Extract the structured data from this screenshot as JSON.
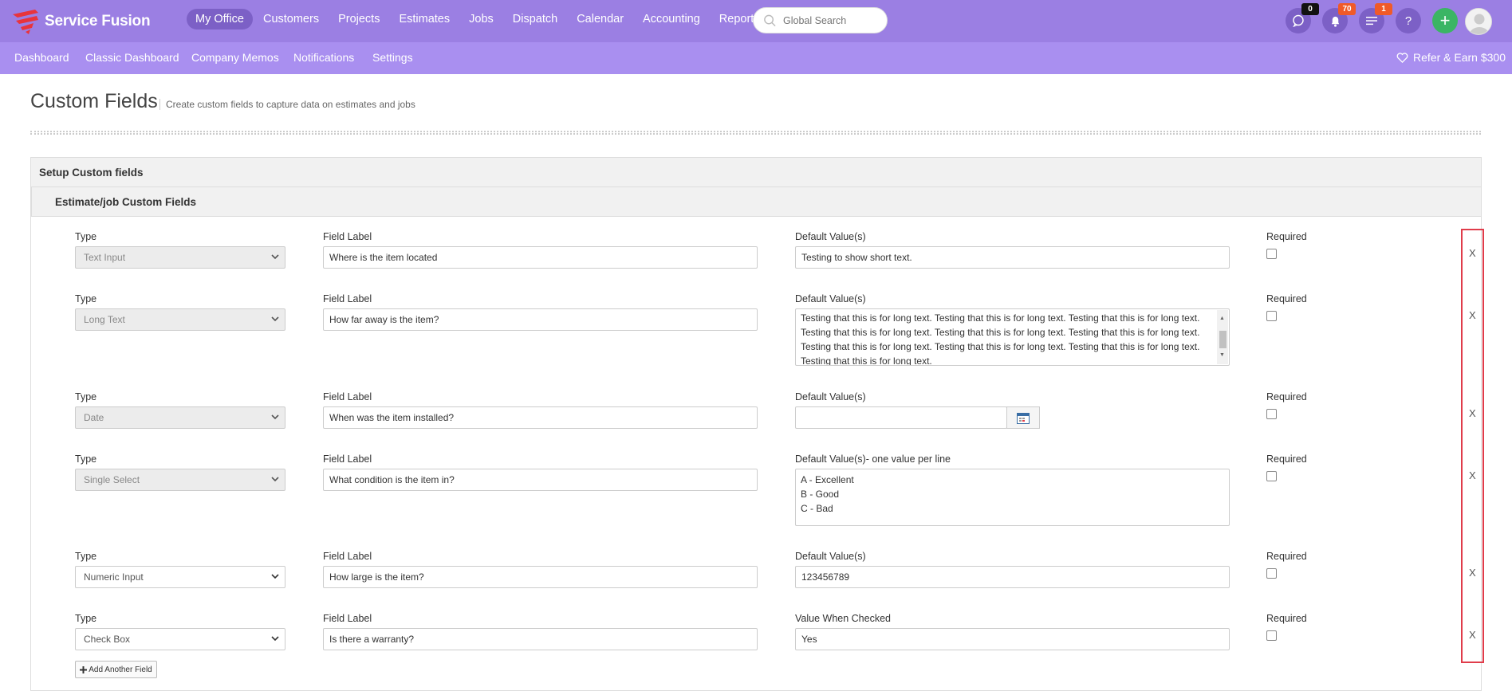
{
  "brand": {
    "name": "Service Fusion"
  },
  "main_nav": [
    "My Office",
    "Customers",
    "Projects",
    "Estimates",
    "Jobs",
    "Dispatch",
    "Calendar",
    "Accounting",
    "Reports"
  ],
  "search": {
    "placeholder": "Global Search"
  },
  "badges": {
    "messages": "0",
    "notifications": "70",
    "tasks": "1"
  },
  "top_icons": {
    "help": "?",
    "add": "+"
  },
  "sub_nav": [
    "Dashboard",
    "Classic Dashboard",
    "Company Memos",
    "Notifications",
    "Settings"
  ],
  "refer": "Refer & Earn $300",
  "page": {
    "title": "Custom Fields",
    "subtitle": "Create custom fields to capture data on estimates and jobs"
  },
  "panel": {
    "title": "Setup Custom fields",
    "subtitle": "Estimate/job Custom Fields"
  },
  "labels": {
    "type": "Type",
    "field_label": "Field Label",
    "required": "Required",
    "remove": "X"
  },
  "fields": [
    {
      "type": "Text Input",
      "label": "Where is the item located",
      "default_label": "Default Value(s)",
      "default": "Testing to show short text."
    },
    {
      "type": "Long Text",
      "label": "How far away is the item?",
      "default_label": "Default Value(s)",
      "default_lines": [
        "Testing that this is for long text. Testing that this is for long text. Testing that this is for long text.",
        "Testing that this is for long text. Testing that this is for long text. Testing that this is for long text.",
        "Testing that this is for long text. Testing that this is for long text. Testing that this is for long text.",
        "Testing that this is for long text."
      ]
    },
    {
      "type": "Date",
      "label": "When was the item installed?",
      "default_label": "Default Value(s)",
      "default": ""
    },
    {
      "type": "Single Select",
      "label": "What condition is the item in?",
      "default_label": "Default Value(s)- one value per line",
      "default_lines": [
        "A - Excellent",
        "B - Good",
        "C - Bad"
      ]
    },
    {
      "type": "Numeric Input",
      "label": "How large is the item?",
      "default_label": "Default Value(s)",
      "default": "123456789"
    },
    {
      "type": "Check Box",
      "label": "Is there a warranty?",
      "default_label": "Value When Checked",
      "default": "Yes"
    }
  ],
  "add_button": "Add Another Field",
  "colors": {
    "primary": "#9b7fe3",
    "subnav": "#a98ff0",
    "accent": "#3bb564",
    "badge": "#f05a28",
    "highlight": "#e03c4a"
  }
}
